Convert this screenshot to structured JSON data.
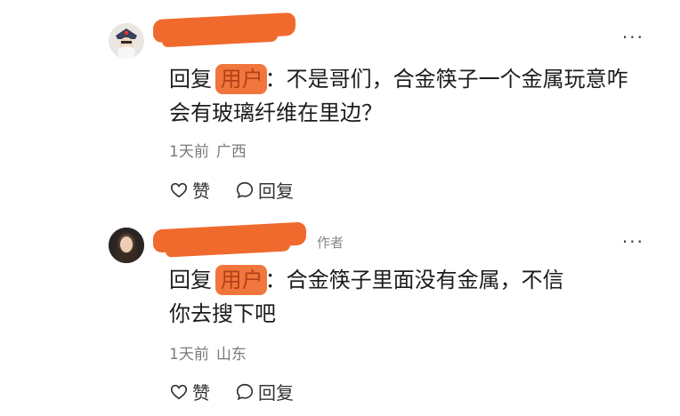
{
  "comments": [
    {
      "avatar_icon": "cartoon-avatar",
      "reply_prefix": "回复",
      "reply_target": "用户",
      "text_line1": "：不是哥们，合金筷子一个金属玩意咋",
      "text_line2": "会有玻璃纤维在里边？",
      "time": "1天前",
      "location": "广西",
      "like_label": "赞",
      "reply_label": "回复",
      "more_label": "···"
    },
    {
      "avatar_icon": "photo-avatar",
      "author_tag": "作者",
      "reply_prefix": "回复",
      "reply_target": "用户",
      "text_line1": "：合金筷子里面没有金属，不信",
      "text_line2": "你去搜下吧",
      "time": "1天前",
      "location": "山东",
      "like_label": "赞",
      "reply_label": "回复",
      "more_label": "···"
    }
  ],
  "colors": {
    "redaction": "#f06a2e",
    "meta_text": "#7a7a7a"
  }
}
